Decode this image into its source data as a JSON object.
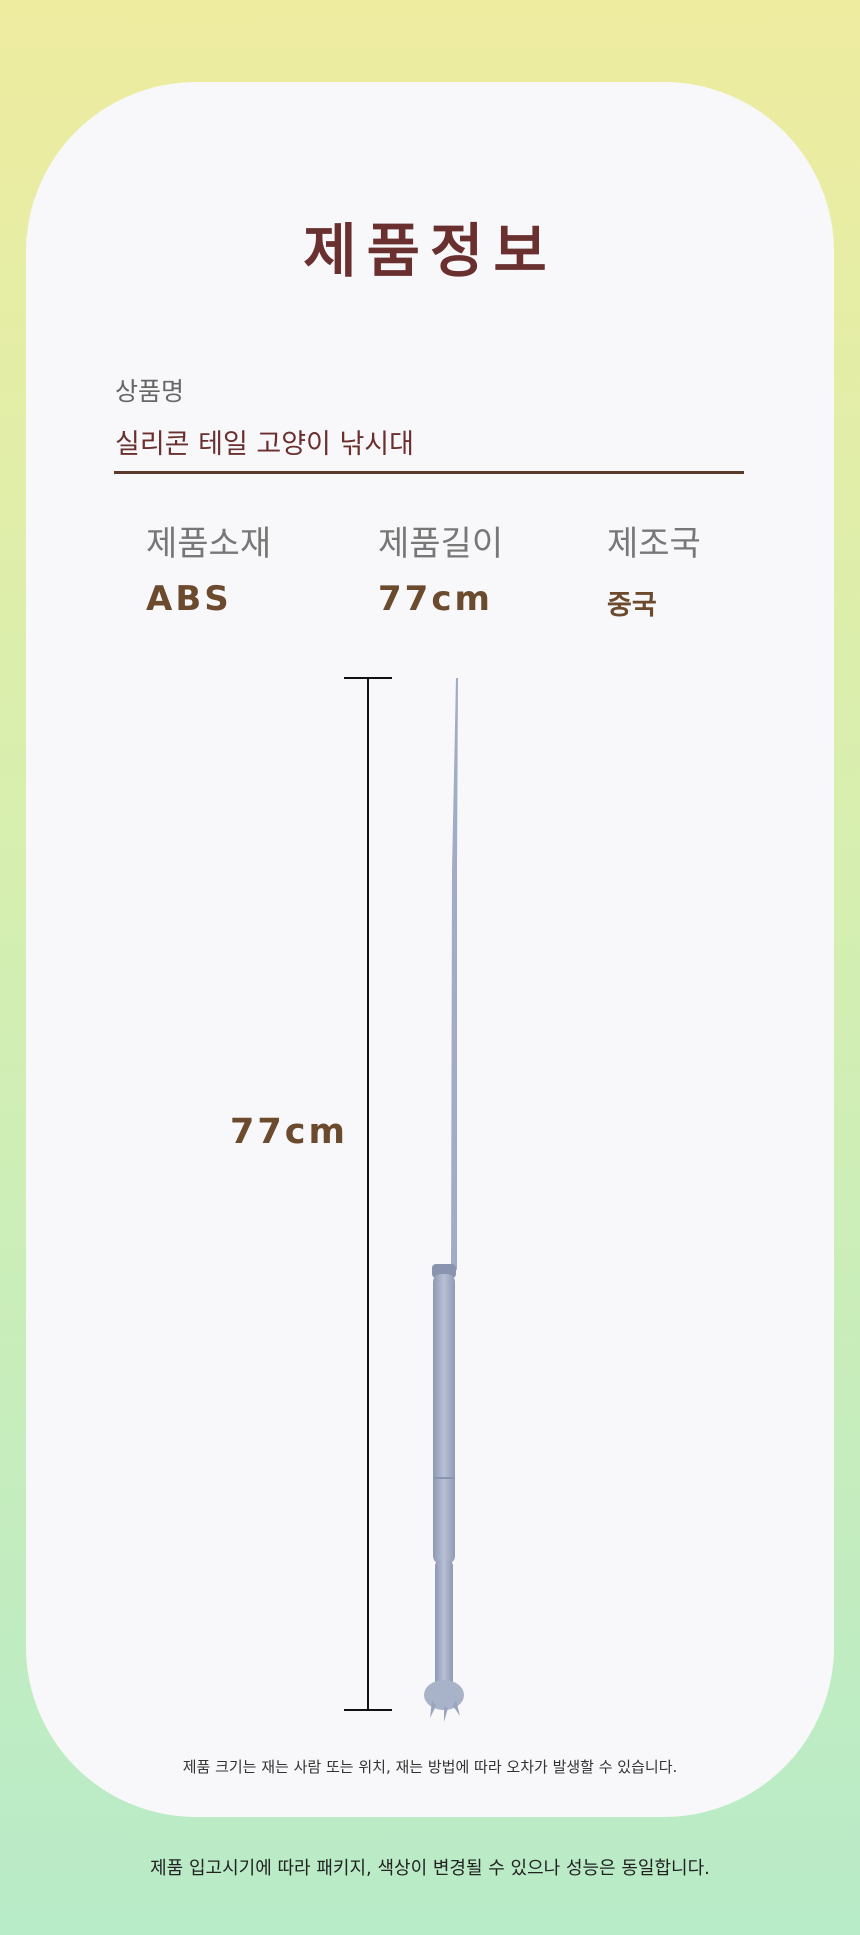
{
  "title": "제품정보",
  "product": {
    "name_label": "상품명",
    "name_value": "실리콘 테일 고양이 낚시대"
  },
  "specs": [
    {
      "label": "제품소재",
      "value": "ABS"
    },
    {
      "label": "제품길이",
      "value": "77cm"
    },
    {
      "label": "제조국",
      "value": "중국"
    }
  ],
  "dimension_label": "77cm",
  "size_note": "제품 크기는 재는 사람 또는 위치, 재는 방법에 따라 오차가 발생할 수 있습니다.",
  "footer_note": "제품 입고시기에 따라 패키지, 색상이 변경될 수 있으나 성능은 동일합니다.",
  "colors": {
    "title": "#6a2f2f",
    "accent_brown": "#6b4a2e",
    "rod": "#a9b3c9",
    "bg_top": "#eeec9f",
    "bg_bottom": "#b8ebc8"
  }
}
